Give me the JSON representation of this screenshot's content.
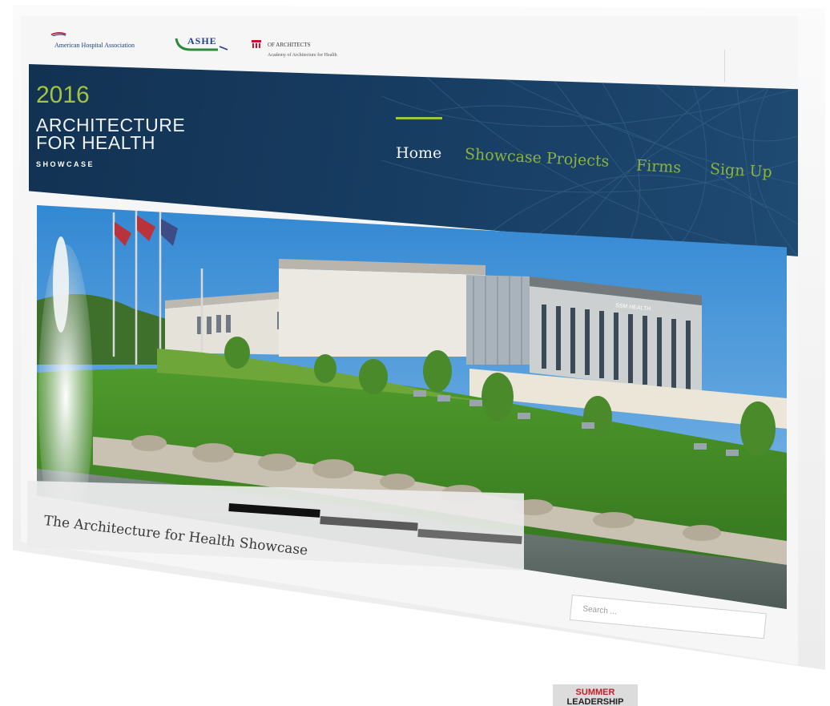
{
  "partners": {
    "aha": "American Hospital Association",
    "ashe": "ASHE",
    "aia_line1": "OF ARCHITECTS",
    "aia_line2": "Academy of Architecture for Health"
  },
  "brand": {
    "year": "2016",
    "line1": "ARCHITECTURE",
    "line2": "FOR HEALTH",
    "sub": "SHOWCASE"
  },
  "nav": {
    "items": [
      {
        "label": "Home",
        "active": true
      },
      {
        "label": "Showcase Projects",
        "active": false
      },
      {
        "label": "Firms",
        "active": false
      },
      {
        "label": "Sign Up",
        "active": false
      }
    ]
  },
  "hero": {
    "caption": "The Architecture for Health Showcase",
    "slides": 3,
    "active_slide": 1,
    "building_sign": "SSM HEALTH"
  },
  "search": {
    "placeholder": "Search ..."
  },
  "badge": {
    "line1": "SUMMER",
    "line2": "LEADERSHIP"
  },
  "colors": {
    "header_bg": "#183e64",
    "accent_green": "#a4c43e",
    "nav_inactive": "#8cb33c",
    "nav_active": "#f2f2f2",
    "badge_red": "#c41f2b"
  }
}
